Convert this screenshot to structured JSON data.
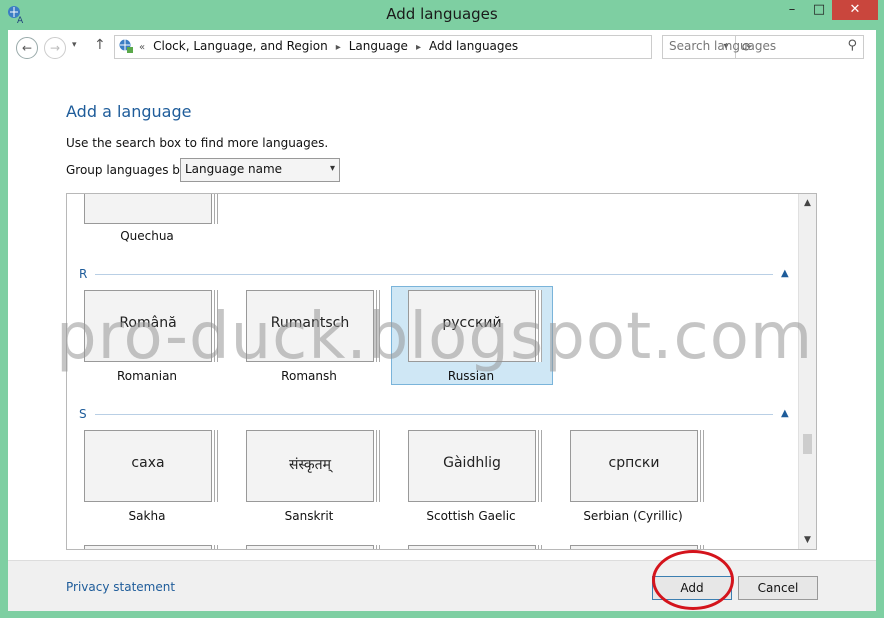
{
  "window": {
    "title": "Add languages",
    "controls": {
      "minimize": "–",
      "maximize": "□",
      "close": "✕"
    }
  },
  "address_bar": {
    "back_glyph": "←",
    "forward_glyph": "→",
    "recent_glyph": "▾",
    "up_glyph": "↑",
    "crumb_prefix": "«",
    "breadcrumbs": [
      "Clock, Language, and Region",
      "Language",
      "Add languages"
    ],
    "separator": "▸",
    "dropdown_glyph": "▾",
    "refresh_glyph": "⟳",
    "search_placeholder": "Search languages",
    "search_glyph": "⚲"
  },
  "main": {
    "heading": "Add a language",
    "hint": "Use the search box to find more languages.",
    "group_label": "Group languages by:",
    "group_value": "Language name",
    "group_arrow": "▾"
  },
  "groups": [
    {
      "letter": "R",
      "collapse": "▲"
    },
    {
      "letter": "S",
      "collapse": "▲"
    }
  ],
  "languages": {
    "quechua": {
      "native": "",
      "name": "Quechua"
    },
    "romanian": {
      "native": "Română",
      "name": "Romanian"
    },
    "romansh": {
      "native": "Rumantsch",
      "name": "Romansh"
    },
    "russian": {
      "native": "русский",
      "name": "Russian",
      "selected": true
    },
    "sakha": {
      "native": "саха",
      "name": "Sakha"
    },
    "sanskrit": {
      "native": "संस्कृतम्",
      "name": "Sanskrit"
    },
    "scottish_gaelic": {
      "native": "Gàidhlig",
      "name": "Scottish Gaelic"
    },
    "serbian_cyrillic": {
      "native": "српски",
      "name": "Serbian (Cyrillic)"
    }
  },
  "scrollbar": {
    "up": "▲",
    "down": "▼"
  },
  "footer": {
    "privacy": "Privacy statement",
    "add": "Add",
    "cancel": "Cancel"
  },
  "watermark": "pro-duck.blogspot.com",
  "colors": {
    "accent": "#1e5c9a",
    "titlebar": "#7ecfa2",
    "close": "#c9463d",
    "selection": "#cfe7f5",
    "annotation": "#d4141c"
  }
}
